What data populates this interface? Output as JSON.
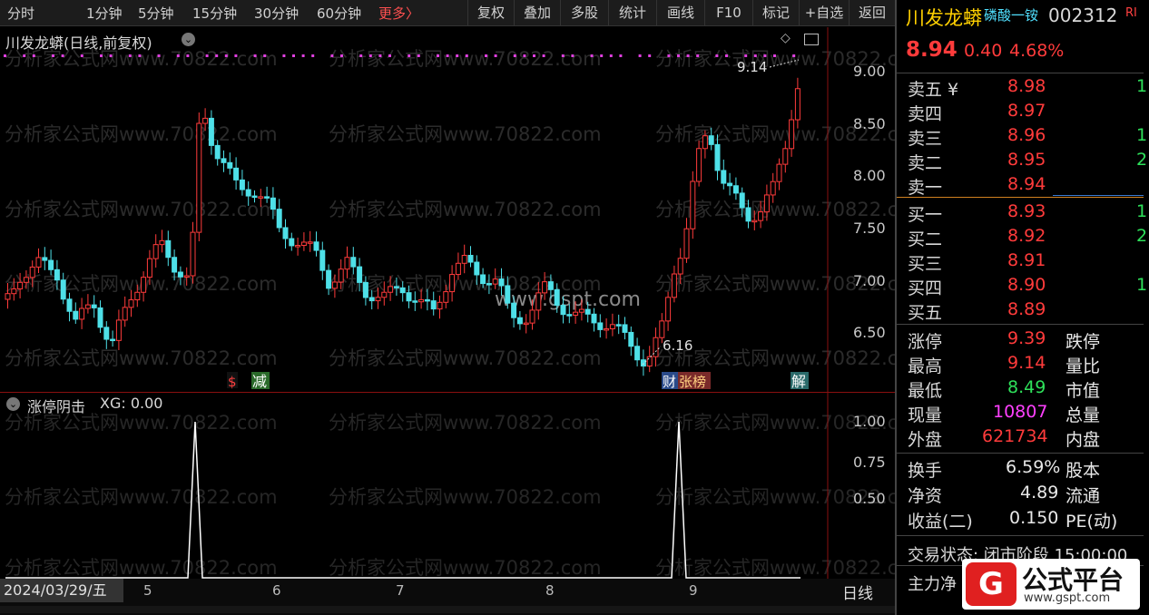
{
  "toolbar": {
    "periods": [
      "分时",
      "1分钟",
      "5分钟",
      "15分钟",
      "30分钟",
      "60分钟"
    ],
    "more": "更多〉",
    "buttons": [
      "复权",
      "叠加",
      "多股",
      "统计",
      "画线",
      "F10",
      "标记",
      "+自选",
      "返回"
    ]
  },
  "main_chart": {
    "title": "川发龙蟒(日线,前复权)",
    "watermark": "分析家公式网www.70822.com",
    "center_watermark": "www.gspt.com",
    "price_axis": [
      "9.00",
      "8.50",
      "8.00",
      "7.50",
      "7.00",
      "6.50"
    ],
    "high_annotation": "9.14",
    "low_annotation": "6.16",
    "event_markers": [
      "$",
      "减",
      "财",
      "张榜",
      "解"
    ]
  },
  "sub_chart": {
    "title": "涨停阴击",
    "indicator": "XG: 0.00",
    "axis": [
      "1.00",
      "0.75",
      "0.50"
    ]
  },
  "date_axis": {
    "date": "2024/03/29/五",
    "months": [
      "5",
      "6",
      "7",
      "8",
      "9"
    ],
    "period": "日线"
  },
  "quote": {
    "name": "川发龙蟒",
    "sector": "磷酸一铵",
    "code": "002312",
    "tag": "RI",
    "price": "8.94",
    "change": "0.40",
    "change_pct": "4.68%",
    "asks": [
      {
        "label": "卖五 ¥",
        "price": "8.98",
        "vol": "1"
      },
      {
        "label": "卖四",
        "price": "8.97",
        "vol": ""
      },
      {
        "label": "卖三",
        "price": "8.96",
        "vol": "1"
      },
      {
        "label": "卖二",
        "price": "8.95",
        "vol": "2"
      },
      {
        "label": "卖一",
        "price": "8.94",
        "vol": ""
      }
    ],
    "bids": [
      {
        "label": "买一",
        "price": "8.93",
        "vol": "1"
      },
      {
        "label": "买二",
        "price": "8.92",
        "vol": "2"
      },
      {
        "label": "买三",
        "price": "8.91",
        "vol": ""
      },
      {
        "label": "买四",
        "price": "8.90",
        "vol": "1"
      },
      {
        "label": "买五",
        "price": "8.89",
        "vol": ""
      }
    ],
    "stats": [
      {
        "l1": "涨停",
        "v1": "9.39",
        "c1": "red",
        "l2": "跌停"
      },
      {
        "l1": "最高",
        "v1": "9.14",
        "c1": "red",
        "l2": "量比"
      },
      {
        "l1": "最低",
        "v1": "8.49",
        "c1": "green",
        "l2": "市值"
      },
      {
        "l1": "现量",
        "v1": "10807",
        "c1": "mag",
        "l2": "总量"
      },
      {
        "l1": "外盘",
        "v1": "621734",
        "c1": "red",
        "l2": "内盘"
      }
    ],
    "stats2": [
      {
        "l1": "换手",
        "v1": "6.59%",
        "l2": "股本"
      },
      {
        "l1": "净资",
        "v1": "4.89",
        "l2": "流通"
      },
      {
        "l1": "收益(二)",
        "v1": "0.150",
        "l2": "PE(动)"
      }
    ],
    "trade_status": "交易状态: 闭市阶段 15:00:00",
    "main_flow": "主力净"
  },
  "logo": {
    "name": "公式平台",
    "url": "www.gspt.com"
  },
  "colors": {
    "up": "#ff3b3b",
    "down": "#4ee0e8",
    "axis_red": "#8a1010"
  }
}
